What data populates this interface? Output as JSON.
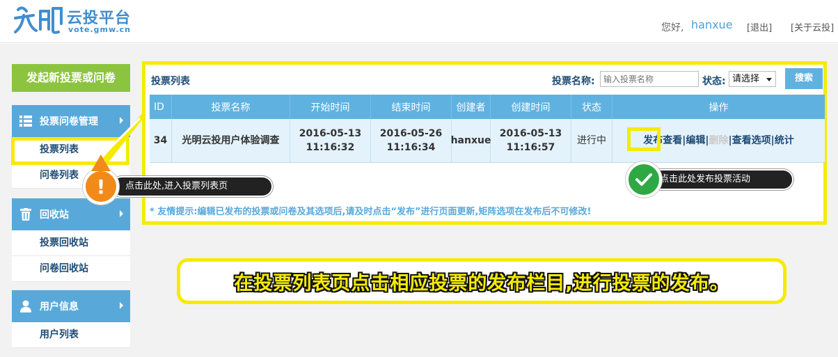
{
  "header": {
    "logo_cn": "云投平台",
    "logo_en": "vote.gmw.cn",
    "greeting": "您好,",
    "username": "hanxue",
    "logout": "[退出]",
    "about": "[关于云投]"
  },
  "sidebar": {
    "new_button": "发起新投票或问卷",
    "sections": [
      {
        "title": "投票问卷管理",
        "icon": "list-icon",
        "items": [
          "投票列表",
          "问卷列表"
        ]
      },
      {
        "title": "回收站",
        "icon": "trash-icon",
        "items": [
          "投票回收站",
          "问卷回收站"
        ]
      },
      {
        "title": "用户信息",
        "icon": "user-icon",
        "items": [
          "用户列表"
        ]
      }
    ]
  },
  "content": {
    "title": "投票列表",
    "search_label": "投票名称:",
    "search_placeholder": "输入投票名称",
    "status_label": "状态:",
    "status_value": "请选择",
    "search_button": "搜索",
    "columns": [
      "ID",
      "投票名称",
      "开始时间",
      "结束时间",
      "创建者",
      "创建时间",
      "状态",
      "操作"
    ],
    "rows": [
      {
        "id": "34",
        "name": "光明云投用户体验调查",
        "start_date": "2016-05-13",
        "start_time": "11:16:32",
        "end_date": "2016-05-26",
        "end_time": "11:16:34",
        "creator": "hanxue",
        "created_date": "2016-05-13",
        "created_time": "11:16:57",
        "status": "进行中",
        "ops": {
          "publish": "发布",
          "view": "查看",
          "edit": "编辑",
          "disabled": "删除",
          "options": "查看选项",
          "stats": "统计",
          "sep": "|"
        }
      }
    ],
    "tip": "* 友情提示:编辑已发布的投票或问卷及其选项后,请及时点击“发布”进行页面更新,矩阵选项在发布后不可修改!"
  },
  "annotations": {
    "tooltip_left": "点击此处,进入投票列表页",
    "tooltip_right": "点击此处发布投票活动",
    "caption": "在投票列表页点击相应投票的发布栏目,进行投票的发布。",
    "badge_left_glyph": "!",
    "colors": {
      "highlight": "#f5eb00",
      "warn": "#f28a1a",
      "ok": "#2ea843",
      "accent": "#58a9da",
      "green_btn": "#8cc43f"
    }
  }
}
